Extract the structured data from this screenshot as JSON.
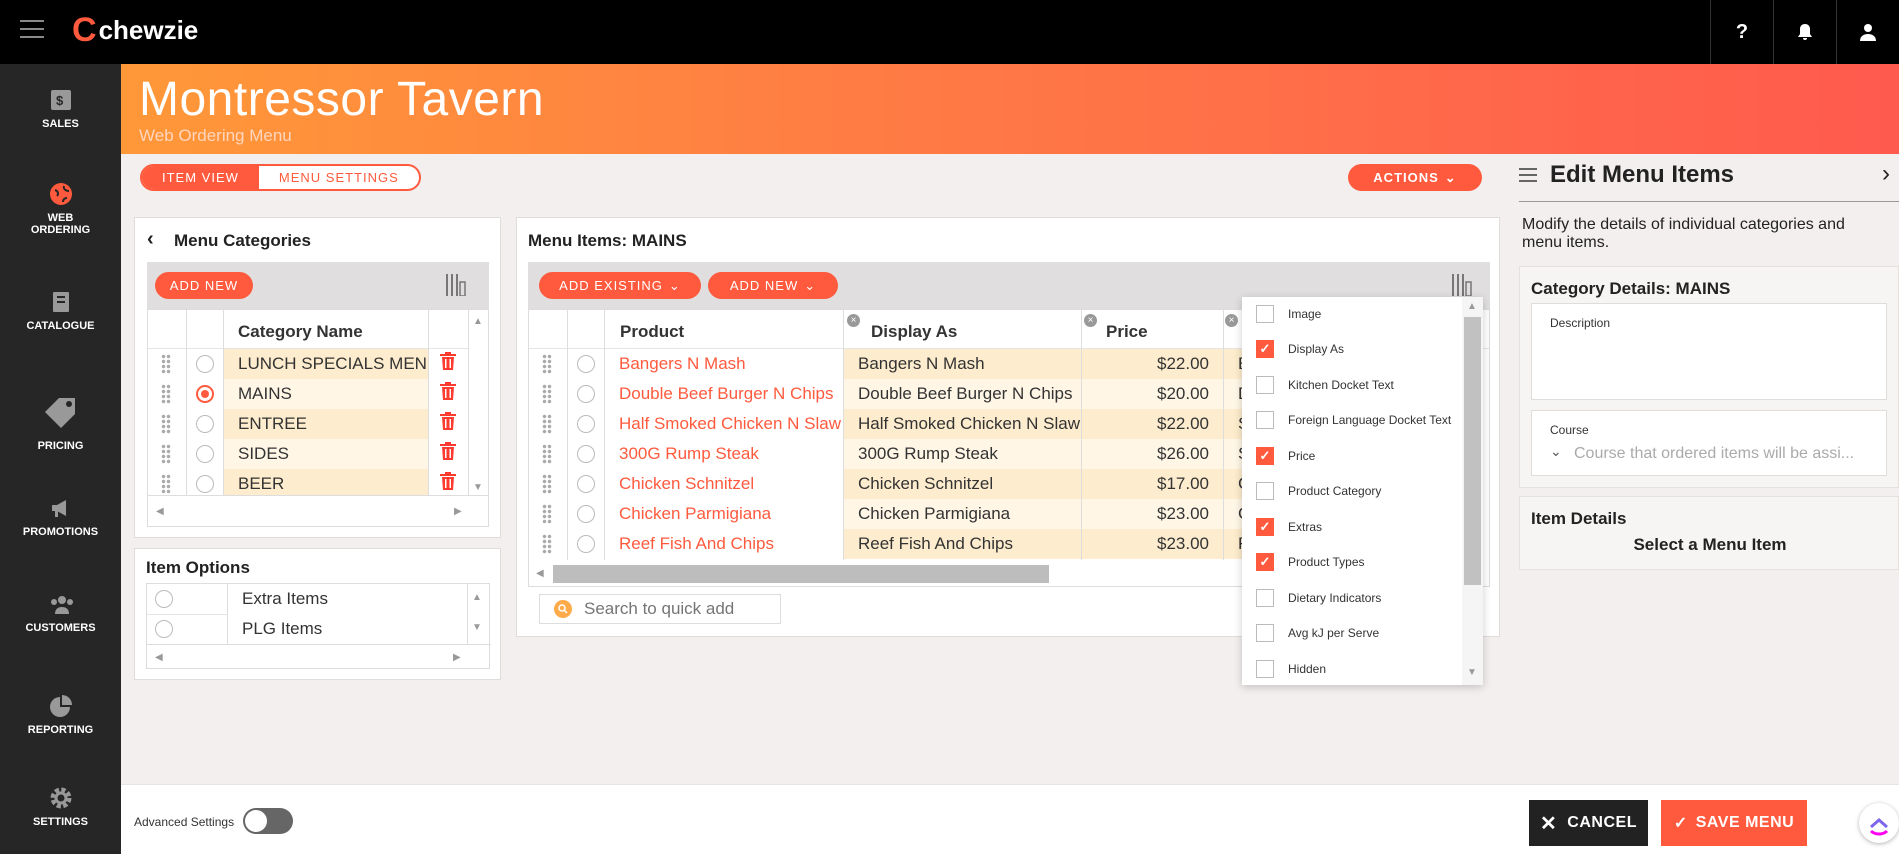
{
  "brand": {
    "name": "chewzie"
  },
  "topbar": {
    "help_icon": "?",
    "bell_icon": "bell",
    "user_icon": "user"
  },
  "nav": [
    {
      "label": "SALES",
      "icon": "sales-icon"
    },
    {
      "label": "WEB ORDERING",
      "icon": "globe-icon",
      "active": true
    },
    {
      "label": "CATALOGUE",
      "icon": "catalogue-icon"
    },
    {
      "label": "PRICING",
      "icon": "tag-icon"
    },
    {
      "label": "PROMOTIONS",
      "icon": "megaphone-icon"
    },
    {
      "label": "CUSTOMERS",
      "icon": "people-icon"
    },
    {
      "label": "REPORTING",
      "icon": "pie-icon"
    },
    {
      "label": "SETTINGS",
      "icon": "gear-icon"
    }
  ],
  "header": {
    "title": "Montressor Tavern",
    "subtitle": "Web Ordering Menu"
  },
  "tabs": {
    "item_view": "ITEM VIEW",
    "menu_settings": "MENU SETTINGS",
    "active": "item_view"
  },
  "actions_label": "ACTIONS",
  "categories": {
    "title": "Menu Categories",
    "add_new": "ADD NEW",
    "column": "Category Name",
    "rows": [
      {
        "name": "LUNCH SPECIALS MENU",
        "selected": false
      },
      {
        "name": "MAINS",
        "selected": true
      },
      {
        "name": "ENTREE",
        "selected": false
      },
      {
        "name": "SIDES",
        "selected": false
      },
      {
        "name": "BEER",
        "selected": false
      }
    ]
  },
  "item_options": {
    "title": "Item Options",
    "rows": [
      "Extra Items",
      "PLG Items"
    ]
  },
  "menu_items": {
    "title": "Menu Items: MAINS",
    "add_existing": "ADD EXISTING",
    "add_new": "ADD NEW",
    "columns": {
      "product": "Product",
      "display_as": "Display As",
      "price": "Price"
    },
    "rows": [
      {
        "product": "Bangers N Mash",
        "display_as": "Bangers N Mash",
        "price": "$22.00",
        "extra": "E"
      },
      {
        "product": "Double Beef Burger N Chips",
        "display_as": "Double Beef Burger N Chips",
        "price": "$20.00",
        "extra": "D"
      },
      {
        "product": "Half Smoked Chicken N Slaw",
        "display_as": "Half Smoked Chicken N Slaw",
        "price": "$22.00",
        "extra": "S"
      },
      {
        "product": "300G Rump Steak",
        "display_as": "300G Rump Steak",
        "price": "$26.00",
        "extra": "S"
      },
      {
        "product": "Chicken Schnitzel",
        "display_as": "Chicken Schnitzel",
        "price": "$17.00",
        "extra": "C"
      },
      {
        "product": "Chicken Parmigiana",
        "display_as": "Chicken Parmigiana",
        "price": "$23.00",
        "extra": "C"
      },
      {
        "product": "Reef Fish And Chips",
        "display_as": "Reef Fish And Chips",
        "price": "$23.00",
        "extra": "F"
      }
    ],
    "search_placeholder": "Search to quick add"
  },
  "column_picker": [
    {
      "label": "Image",
      "checked": false
    },
    {
      "label": "Display As",
      "checked": true
    },
    {
      "label": "Kitchen Docket Text",
      "checked": false
    },
    {
      "label": "Foreign Language Docket Text",
      "checked": false
    },
    {
      "label": "Price",
      "checked": true
    },
    {
      "label": "Product Category",
      "checked": false
    },
    {
      "label": "Extras",
      "checked": true
    },
    {
      "label": "Product Types",
      "checked": true
    },
    {
      "label": "Dietary Indicators",
      "checked": false
    },
    {
      "label": "Avg kJ per Serve",
      "checked": false
    },
    {
      "label": "Hidden",
      "checked": false
    }
  ],
  "edit_panel": {
    "title": "Edit Menu Items",
    "description": "Modify the details of individual categories and menu items.",
    "category_details_title": "Category Details: MAINS",
    "description_label": "Description",
    "course_label": "Course",
    "course_placeholder": "Course that ordered items will be assi...",
    "item_details_title": "Item Details",
    "item_details_msg": "Select a Menu Item"
  },
  "footer": {
    "advanced_settings": "Advanced Settings",
    "cancel": "CANCEL",
    "save": "SAVE MENU"
  },
  "colors": {
    "accent": "#ff5a3d",
    "sidebar": "#262626",
    "topbar": "#000000",
    "row_alt": "#fdeccd"
  }
}
